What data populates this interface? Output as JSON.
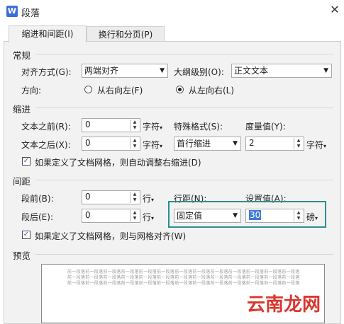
{
  "window": {
    "title": "段落",
    "app_icon_letter": "W"
  },
  "tabs": [
    {
      "label": "缩进和间距(I)",
      "active": true
    },
    {
      "label": "换行和分页(P)",
      "active": false
    }
  ],
  "general": {
    "section": "常规",
    "alignment_label": "对齐方式(G):",
    "alignment_value": "两端对齐",
    "outline_label": "大纲级别(O):",
    "outline_value": "正文文本",
    "direction_label": "方向:",
    "rtl_label": "从右向左(F)",
    "ltr_label": "从左向右(L)",
    "selected_direction": "ltr"
  },
  "indent": {
    "section": "缩进",
    "before_label": "文本之前(R):",
    "before_value": "0",
    "after_label": "文本之后(X):",
    "after_value": "0",
    "unit": "字符",
    "special_label": "特殊格式(S):",
    "special_value": "首行缩进",
    "measure_label": "度量值(Y):",
    "measure_value": "2",
    "measure_unit": "字符",
    "grid_checkbox": "如果定义了文档网格，则自动调整右缩进(D)",
    "grid_checked": true
  },
  "spacing": {
    "section": "间距",
    "before_label": "段前(B):",
    "before_value": "0",
    "after_label": "段后(E):",
    "after_value": "0",
    "unit": "行",
    "line_spacing_label": "行距(N):",
    "line_spacing_value": "固定值",
    "setting_label": "设置值(A):",
    "setting_value": "30",
    "setting_unit": "磅",
    "grid_checkbox": "如果定义了文档网格，则与网格对齐(W)",
    "grid_checked": true
  },
  "preview": {
    "section": "预览",
    "line1": "前一段落前一段落前一段落前一段落前一段落前一段落前一段落前一段落前一段落前一段落前一段落前一段落前一段落",
    "line2": "前一段落前一段落前一段落前一段落前一段落前一段落前一段落前一段落前一段落前一段落前一段落前一段落前一段落",
    "line3": "前一段落前一段落前一段落前一段落前一段落前一段落前一段落前一段落前一段落前一段落前一段落前一段落前一段落"
  },
  "watermark": "云南龙网",
  "colors": {
    "highlight": "#2b8f8f",
    "selection": "#3f7bd6",
    "watermark": "#d9362e"
  }
}
